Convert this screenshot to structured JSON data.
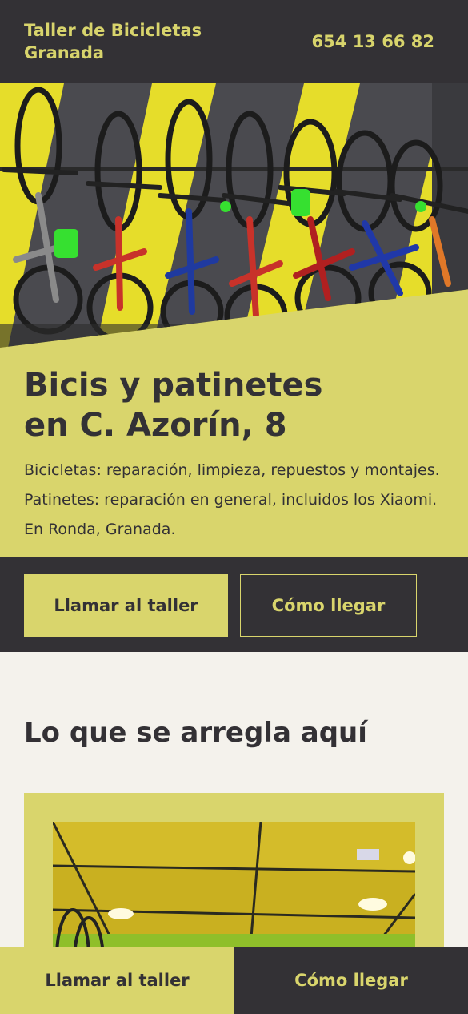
{
  "header": {
    "brand": "Taller de Bicicletas Granada",
    "phone": "654 13 66 82"
  },
  "hero": {
    "title_line1": "Bicis y patinetes",
    "title_line2": "en C. Azorín, 8",
    "description": "Bicicletas: reparación, limpieza, repuestos y montajes. Patinetes: reparación en general, incluidos los Xiaomi. En Ronda, Granada."
  },
  "cta": {
    "call_label": "Llamar al taller",
    "directions_label": "Cómo llegar"
  },
  "services": {
    "title": "Lo que se arregla aquí"
  },
  "sticky_bar": {
    "call_label": "Llamar al taller",
    "directions_label": "Cómo llegar"
  },
  "colors": {
    "accent": "#d9d56c",
    "dark": "#333135",
    "background": "#f4f2ec"
  }
}
